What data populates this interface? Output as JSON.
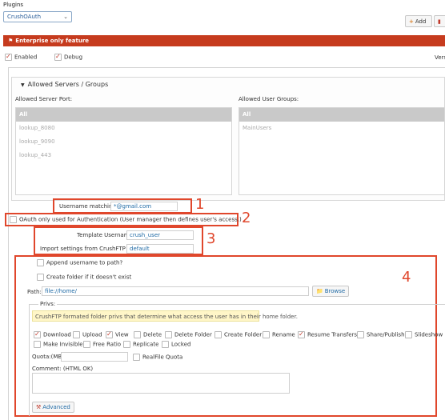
{
  "header": {
    "title": "Plugins",
    "plugin_select": "CrushOAuth",
    "add_label": "Add",
    "remove_label": ""
  },
  "banner": {
    "text": "Enterprise only feature"
  },
  "options": {
    "enabled_label": "Enabled",
    "enabled_checked": true,
    "debug_label": "Debug",
    "debug_checked": true,
    "version_label": "Vers"
  },
  "servers": {
    "section_title": "Allowed Servers / Groups",
    "server_port_label": "Allowed Server Port:",
    "server_ports": [
      "All",
      "lookup_8080",
      "lookup_9090",
      "lookup_443"
    ],
    "user_groups_label": "Allowed User Groups:",
    "user_groups": [
      "All",
      "MainUsers"
    ]
  },
  "username_matching": {
    "label": "Username matching:",
    "value": "*@gmail.com"
  },
  "oauth_only": {
    "label": "OAuth only used for Authentication (User manager then defines user's access.)",
    "checked": false
  },
  "template": {
    "template_username_label": "Template Username:",
    "template_username_value": "crush_user",
    "import_label": "Import settings from CrushFTP user:",
    "import_value": "default"
  },
  "folder": {
    "append_label": "Append username to path?",
    "create_label": "Create folder if it doesn't exist",
    "path_label": "Path:",
    "path_value": "file://home/",
    "browse_label": "Browse"
  },
  "privs": {
    "legend": "Privs:",
    "note": "CrushFTP formated folder privs that determine what access the user has in their home folder.",
    "items": [
      {
        "label": "Download",
        "checked": true
      },
      {
        "label": "Upload",
        "checked": false
      },
      {
        "label": "View",
        "checked": true
      },
      {
        "label": "Delete",
        "checked": false
      },
      {
        "label": "Delete Folder",
        "checked": false
      },
      {
        "label": "Create Folder",
        "checked": false
      },
      {
        "label": "Rename",
        "checked": false
      },
      {
        "label": "Resume Transfers",
        "checked": true
      },
      {
        "label": "Share/Publish",
        "checked": false
      },
      {
        "label": "Slideshow",
        "checked": false
      },
      {
        "label": "Make Invisible",
        "checked": false
      },
      {
        "label": "Free Ratio",
        "checked": false
      },
      {
        "label": "Replicate",
        "checked": false
      },
      {
        "label": "Locked",
        "checked": false
      }
    ],
    "quota_label": "Quota:(MB)",
    "quota_value": "",
    "realfile_label": "RealFile Quota",
    "comment_label": "Comment: (HTML OK)",
    "comment_value": "",
    "advanced_label": "Advanced"
  },
  "annotations": [
    "1",
    "2",
    "3",
    "4"
  ],
  "colors": {
    "banner": "#c63b1e",
    "annotation": "#e0472c",
    "accent_text": "#1f6aa5"
  }
}
